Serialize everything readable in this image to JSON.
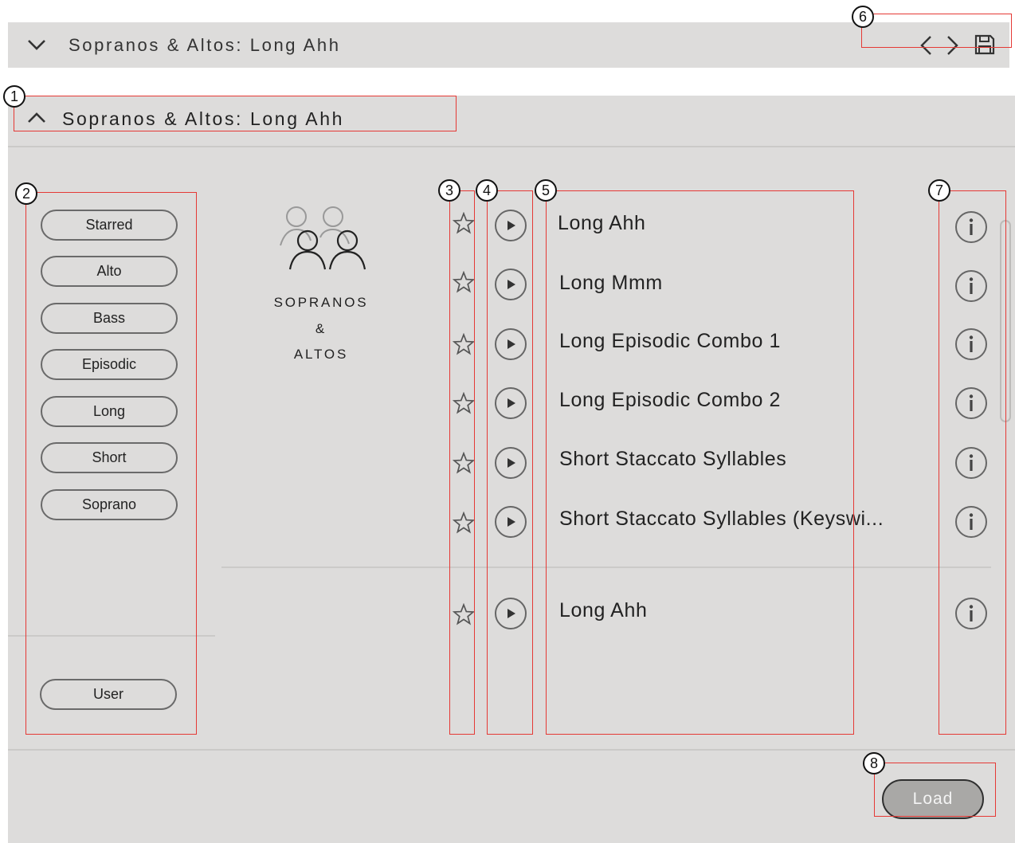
{
  "header": {
    "title": "Sopranos & Altos: Long Ahh",
    "icons": {
      "collapse": "chevron-down-icon",
      "prev": "chevron-left-icon",
      "next": "chevron-right-icon",
      "save": "save-icon"
    }
  },
  "panel": {
    "title": "Sopranos & Altos: Long Ahh",
    "toggle_icon": "chevron-up-icon"
  },
  "tags": [
    "Starred",
    "Alto",
    "Bass",
    "Episodic",
    "Long",
    "Short",
    "Soprano"
  ],
  "user_tag": "User",
  "category": {
    "icon": "people-group-icon",
    "line1": "SOPRANOS",
    "line2": "&",
    "line3": "ALTOS"
  },
  "presets": [
    {
      "name": "Long Ahh"
    },
    {
      "name": "Long Mmm"
    },
    {
      "name": "Long Episodic Combo 1"
    },
    {
      "name": "Long Episodic Combo 2"
    },
    {
      "name": "Short Staccato Syllables"
    },
    {
      "name": "Short Staccato Syllables (Keyswi..."
    }
  ],
  "user_presets": [
    {
      "name": "Long Ahh"
    }
  ],
  "row_icons": {
    "star": "star-icon",
    "play": "play-icon",
    "info": "info-icon"
  },
  "load_button": "Load",
  "annotations": [
    "1",
    "2",
    "3",
    "4",
    "5",
    "6",
    "7",
    "8"
  ],
  "colors": {
    "panel_bg": "#dddcdb",
    "highlight": "#e53935",
    "load_bg": "#a9a8a6"
  }
}
